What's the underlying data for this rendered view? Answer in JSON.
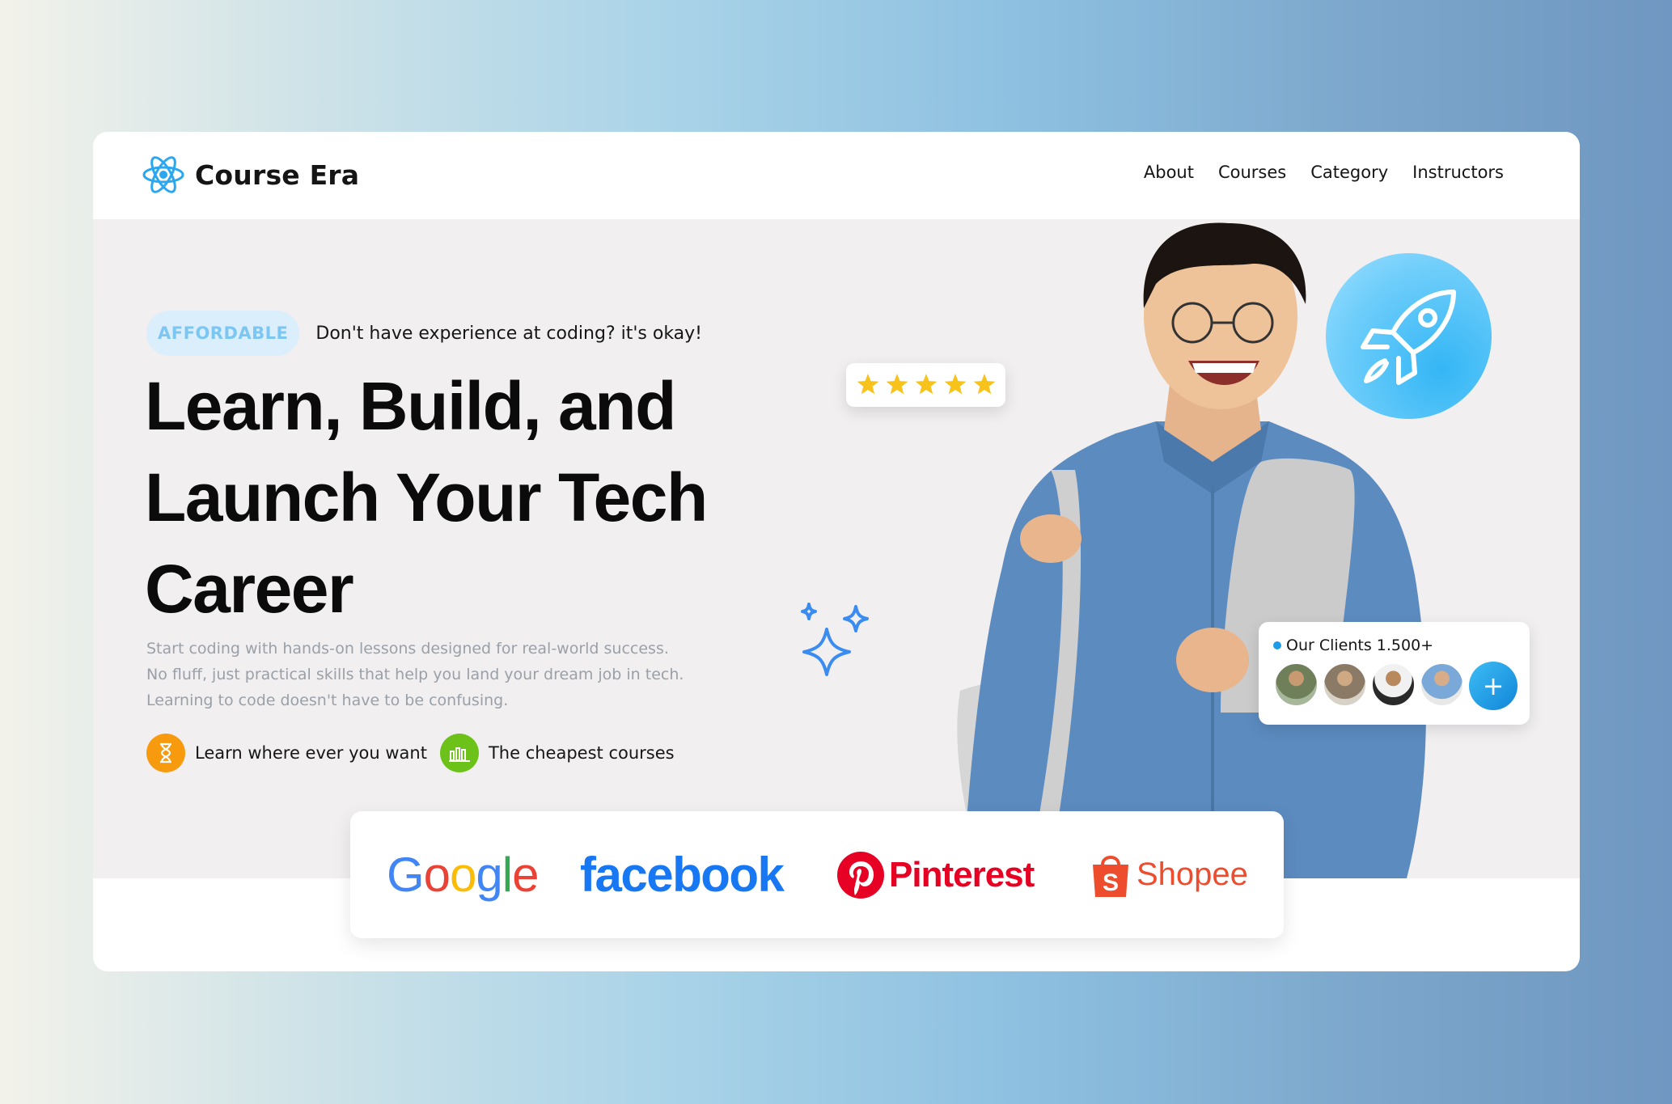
{
  "brand": {
    "name": "Course Era",
    "logo_icon": "atom-icon",
    "accent": "#1e9be8"
  },
  "nav": {
    "items": [
      "About",
      "Courses",
      "Category",
      "Instructors"
    ]
  },
  "hero": {
    "badge": "AFFORDABLE",
    "badge_text": "Don't have experience at coding? it's okay!",
    "headline_lines": [
      "Learn, Build, and",
      "Launch Your Tech",
      "Career"
    ],
    "description_lines": [
      "Start coding with hands-on lessons designed for real-world success.",
      "No fluff, just practical skills that help you land your dream job in tech.",
      "Learning to code doesn't have to be confusing."
    ],
    "features": [
      {
        "label": "Learn where ever you want",
        "icon": "hourglass-icon",
        "color": "#f79a0e"
      },
      {
        "label": "The cheapest courses",
        "icon": "bar-chart-icon",
        "color": "#6dc21a"
      }
    ]
  },
  "rating": {
    "stars": 5,
    "max": 5,
    "color": "#f7c21a"
  },
  "clients": {
    "label": "Our Clients 1.500+",
    "avatar_count": 4,
    "add_label": "+"
  },
  "partners": {
    "google": "Google",
    "facebook": "facebook",
    "pinterest": "Pinterest",
    "shopee": "Shopee"
  }
}
